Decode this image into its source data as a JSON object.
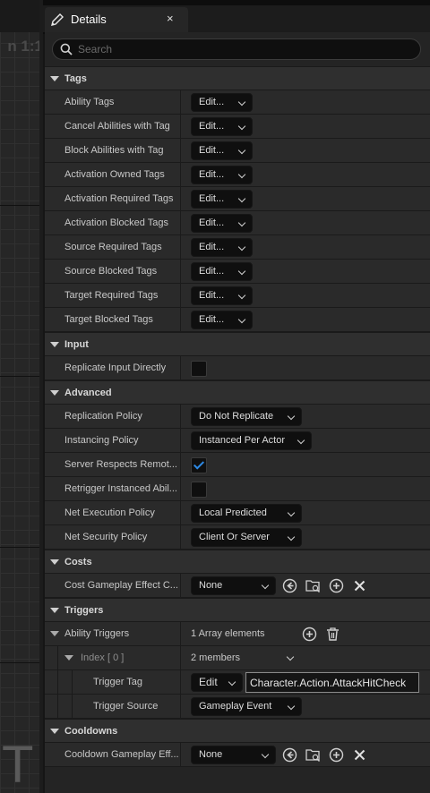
{
  "graph_label": "n 1:1",
  "graph_bigT": "T",
  "tab": {
    "title": "Details",
    "close": "×"
  },
  "search": {
    "placeholder": "Search"
  },
  "sections": {
    "tags": {
      "title": "Tags",
      "edit_label": "Edit...",
      "items": [
        "Ability Tags",
        "Cancel Abilities with Tag",
        "Block Abilities with Tag",
        "Activation Owned Tags",
        "Activation Required Tags",
        "Activation Blocked Tags",
        "Source Required Tags",
        "Source Blocked Tags",
        "Target Required Tags",
        "Target Blocked Tags"
      ]
    },
    "input": {
      "title": "Input",
      "replicate_input_directly": {
        "label": "Replicate Input Directly",
        "checked": false
      }
    },
    "advanced": {
      "title": "Advanced",
      "replication_policy": {
        "label": "Replication Policy",
        "value": "Do Not Replicate"
      },
      "instancing_policy": {
        "label": "Instancing Policy",
        "value": "Instanced Per Actor"
      },
      "server_respects": {
        "label": "Server Respects Remot...",
        "checked": true
      },
      "retrigger": {
        "label": "Retrigger Instanced Abil...",
        "checked": false
      },
      "net_execution_policy": {
        "label": "Net Execution Policy",
        "value": "Local Predicted"
      },
      "net_security_policy": {
        "label": "Net Security Policy",
        "value": "Client Or Server"
      }
    },
    "costs": {
      "title": "Costs",
      "cost_gameplay_effect": {
        "label": "Cost Gameplay Effect C...",
        "value": "None"
      }
    },
    "triggers": {
      "title": "Triggers",
      "ability_triggers": {
        "label": "Ability Triggers",
        "value": "1 Array elements"
      },
      "index": {
        "label": "Index [ 0 ]",
        "value": "2 members"
      },
      "trigger_tag": {
        "label": "Trigger Tag",
        "edit": "Edit",
        "value": "Character.Action.AttackHitCheck"
      },
      "trigger_source": {
        "label": "Trigger Source",
        "value": "Gameplay Event"
      }
    },
    "cooldowns": {
      "title": "Cooldowns",
      "cooldown_gameplay_effect": {
        "label": "Cooldown Gameplay Eff...",
        "value": "None"
      }
    }
  }
}
